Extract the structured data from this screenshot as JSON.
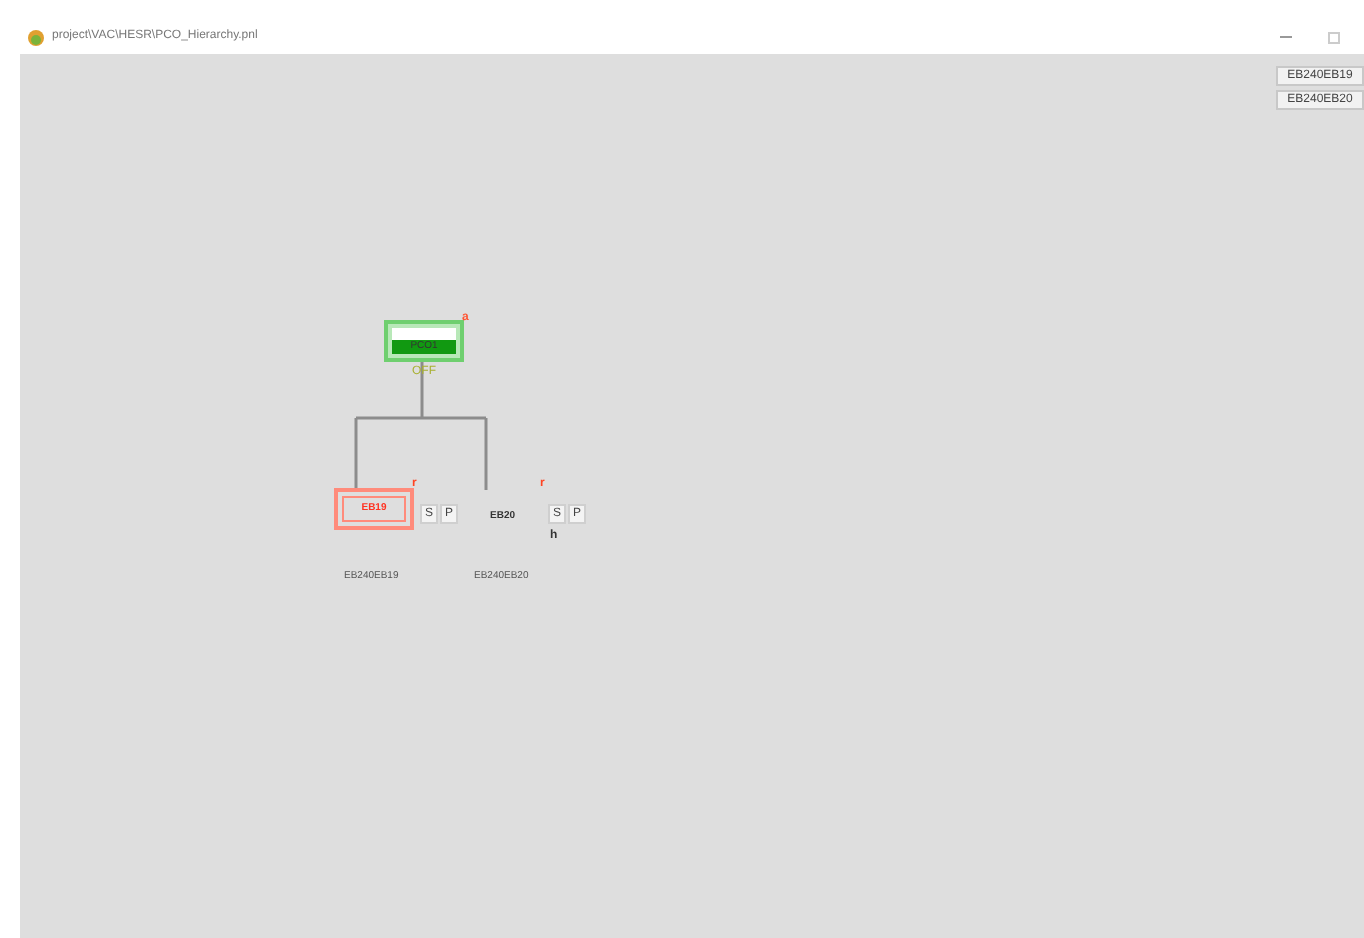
{
  "window": {
    "title": "project\\VAC\\HESR\\PCO_Hierarchy.pnl"
  },
  "top_buttons": [
    "EB240EB19",
    "EB240EB20"
  ],
  "root": {
    "label": "PCO1",
    "marker": "a",
    "state": "OFF"
  },
  "children": [
    {
      "label": "EB19",
      "kind": "boxed",
      "marker": "r",
      "buttons": [
        "S",
        "P"
      ],
      "caption": "EB240EB19"
    },
    {
      "label": "EB20",
      "kind": "plain",
      "marker": "r",
      "buttons": [
        "S",
        "P"
      ],
      "note": "h",
      "caption": "EB240EB20"
    }
  ]
}
